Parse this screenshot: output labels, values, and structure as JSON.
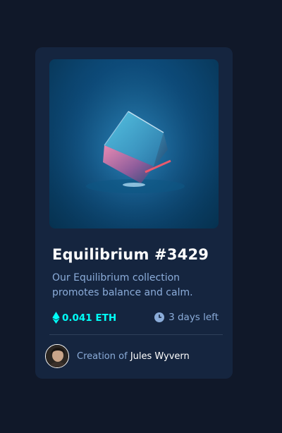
{
  "card": {
    "title": "Equilibrium #3429",
    "description": "Our Equilibrium collection promotes balance and calm.",
    "price": "0.041 ETH",
    "time_left": "3 days left",
    "creator_prefix": "Creation of",
    "creator_name": "Jules Wyvern"
  },
  "icons": {
    "price": "ethereum-icon",
    "time": "clock-icon",
    "avatar": "avatar-photo"
  },
  "colors": {
    "page_background": "#101829",
    "card_background": "#15253f",
    "accent_cyan": "#00fff8",
    "soft_blue": "#8bacd9",
    "white": "#ffffff"
  }
}
